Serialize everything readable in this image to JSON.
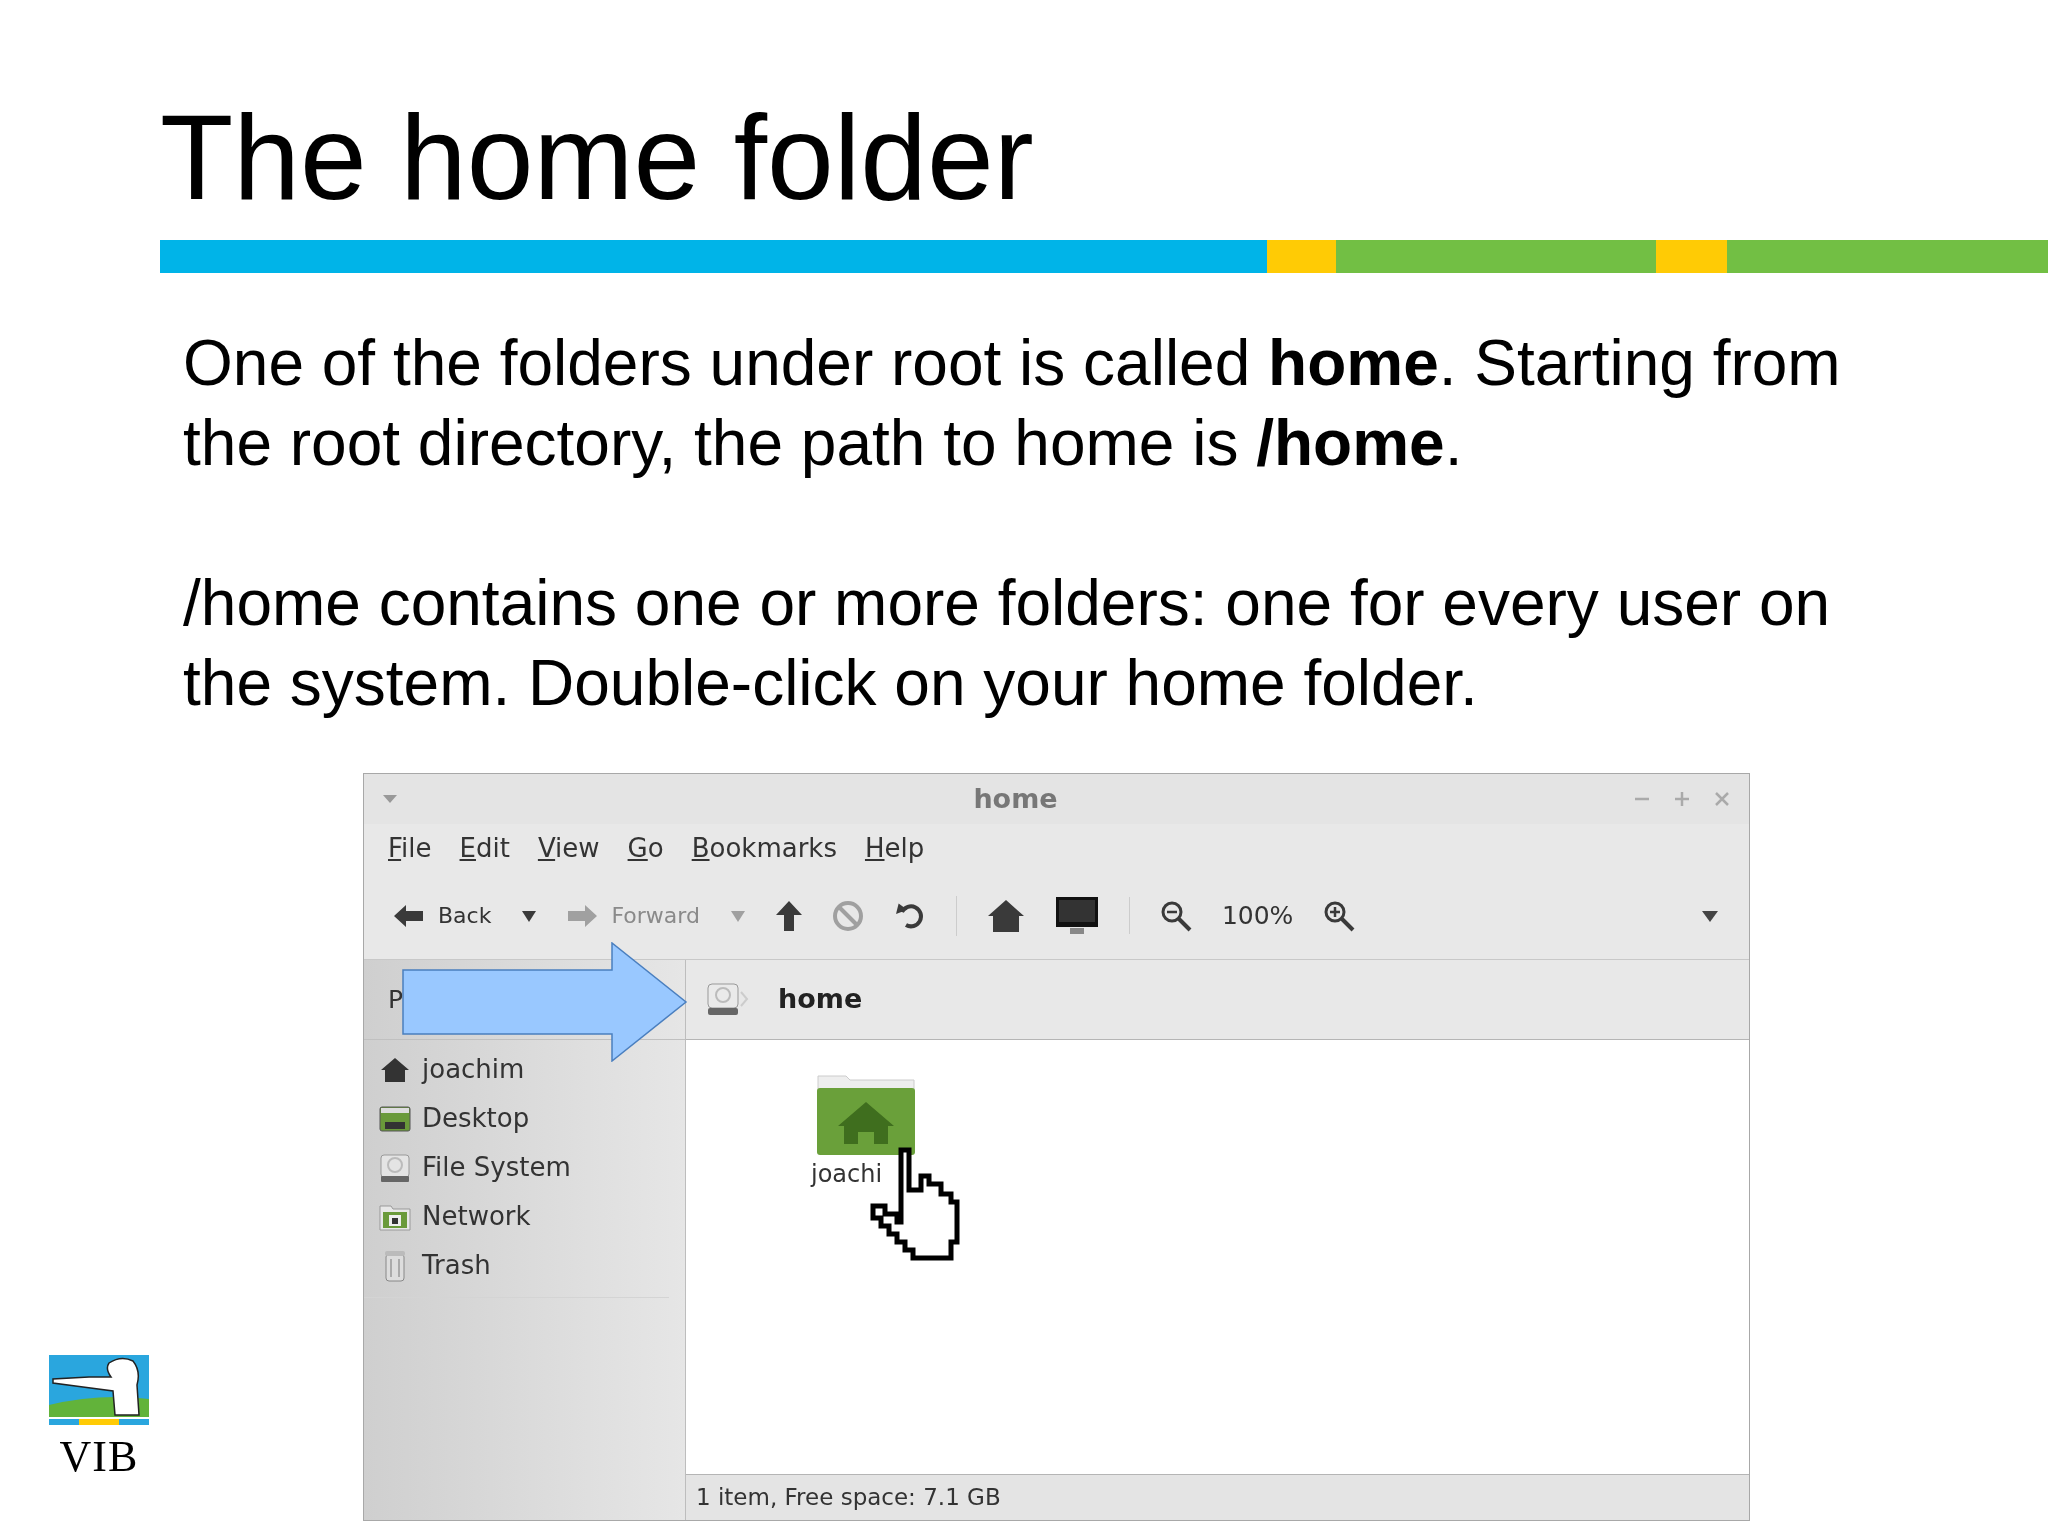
{
  "slide": {
    "title": "The home folder",
    "paragraphs": [
      "One of the folders under root is called **home**. Starting from the root directory, the path to home is **/home**.",
      "/home contains one or more folders: one for every user on the system. Double-click on your home folder."
    ]
  },
  "logo": {
    "text": "VIB"
  },
  "window": {
    "title": "home",
    "menus": [
      "File",
      "Edit",
      "View",
      "Go",
      "Bookmarks",
      "Help"
    ],
    "toolbar": {
      "groups": [
        [
          {
            "kind": "back",
            "label": "Back",
            "disabled": false
          },
          {
            "kind": "caret",
            "disabled": false
          },
          {
            "kind": "forward",
            "label": "Forward",
            "disabled": true
          },
          {
            "kind": "caret",
            "disabled": true
          },
          {
            "kind": "up",
            "disabled": false
          },
          {
            "kind": "stop",
            "disabled": true
          },
          {
            "kind": "reload",
            "disabled": false
          }
        ],
        [
          {
            "kind": "home",
            "disabled": false
          },
          {
            "kind": "computer",
            "disabled": false
          }
        ],
        [
          {
            "kind": "zoom-out",
            "disabled": false
          },
          {
            "kind": "zoom-level",
            "label": "100%",
            "disabled": false
          },
          {
            "kind": "zoom-in",
            "disabled": false
          }
        ]
      ]
    },
    "sidebar": {
      "header": "P",
      "places": [
        {
          "kind": "home",
          "label": "joachim"
        },
        {
          "kind": "desktop",
          "label": "Desktop"
        },
        {
          "kind": "drive",
          "label": "File System"
        },
        {
          "kind": "network",
          "label": "Network"
        },
        {
          "kind": "trash",
          "label": "Trash"
        }
      ]
    },
    "path_bar": {
      "segments": [
        {
          "label": "home",
          "selected": true
        }
      ]
    },
    "files": [
      {
        "kind": "home-folder",
        "label": "joachi"
      }
    ],
    "status_bar": "1 item, Free space: 7.1 GB"
  }
}
